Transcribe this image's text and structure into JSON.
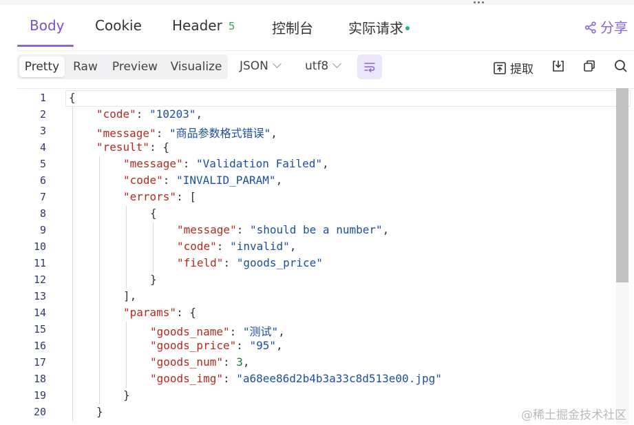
{
  "tabs": {
    "body": "Body",
    "cookie": "Cookie",
    "header": "Header",
    "header_count": "5",
    "console": "控制台",
    "actual_request": "实际请求",
    "share": "分享"
  },
  "toolbar": {
    "pretty": "Pretty",
    "raw": "Raw",
    "preview": "Preview",
    "visualize": "Visualize",
    "format": "JSON",
    "encoding": "utf8",
    "extract": "提取"
  },
  "line_numbers": [
    "1",
    "2",
    "3",
    "4",
    "5",
    "6",
    "7",
    "8",
    "9",
    "10",
    "11",
    "12",
    "13",
    "14",
    "15",
    "16",
    "17",
    "18",
    "19",
    "20"
  ],
  "json": {
    "code_key": "\"code\"",
    "code_val": "\"10203\"",
    "message_key": "\"message\"",
    "message_val": "\"商品参数格式错误\"",
    "result_key": "\"result\"",
    "r_message_key": "\"message\"",
    "r_message_val": "\"Validation Failed\"",
    "r_code_key": "\"code\"",
    "r_code_val": "\"INVALID_PARAM\"",
    "errors_key": "\"errors\"",
    "e_message_key": "\"message\"",
    "e_message_val": "\"should be a number\"",
    "e_code_key": "\"code\"",
    "e_code_val": "\"invalid\"",
    "e_field_key": "\"field\"",
    "e_field_val": "\"goods_price\"",
    "params_key": "\"params\"",
    "goods_name_key": "\"goods_name\"",
    "goods_name_val": "\"测试\"",
    "goods_price_key": "\"goods_price\"",
    "goods_price_val": "\"95\"",
    "goods_num_key": "\"goods_num\"",
    "goods_num_val": "3",
    "goods_img_key": "\"goods_img\"",
    "goods_img_val": "\"a68ee86d2b4b3a33c8d513e00.jpg\""
  },
  "watermark": "@稀土掘金技术社区",
  "colors": {
    "accent": "#8a63e0",
    "key": "#b52a1d",
    "string": "#1a4fa3",
    "number": "#1a7a3a",
    "badge": "#3aa55a"
  },
  "icons": [
    "share-icon",
    "wrap-lines-icon",
    "extract-icon",
    "download-icon",
    "copy-icon",
    "search-icon"
  ]
}
